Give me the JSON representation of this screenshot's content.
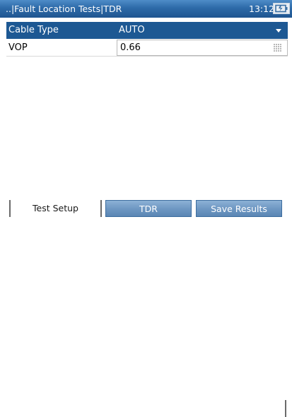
{
  "header": {
    "breadcrumb": "..|Fault Location Tests|TDR",
    "time": "13:12"
  },
  "settings": {
    "cable_type": {
      "label": "Cable Type",
      "value": "AUTO"
    },
    "vop": {
      "label": "VOP",
      "value": "0.66"
    }
  },
  "tabs": [
    {
      "label": "Test Setup",
      "active": true
    },
    {
      "label": "TDR",
      "active": false
    },
    {
      "label": "Save Results",
      "active": false
    }
  ],
  "colors": {
    "title_bar": "#2d6aa8",
    "selected_row": "#1d5893",
    "inactive_tab": "#6f98c3"
  },
  "icons": {
    "status": "battery-icon",
    "dropdown": "chevron-down-icon",
    "keypad": "keypad-icon"
  }
}
